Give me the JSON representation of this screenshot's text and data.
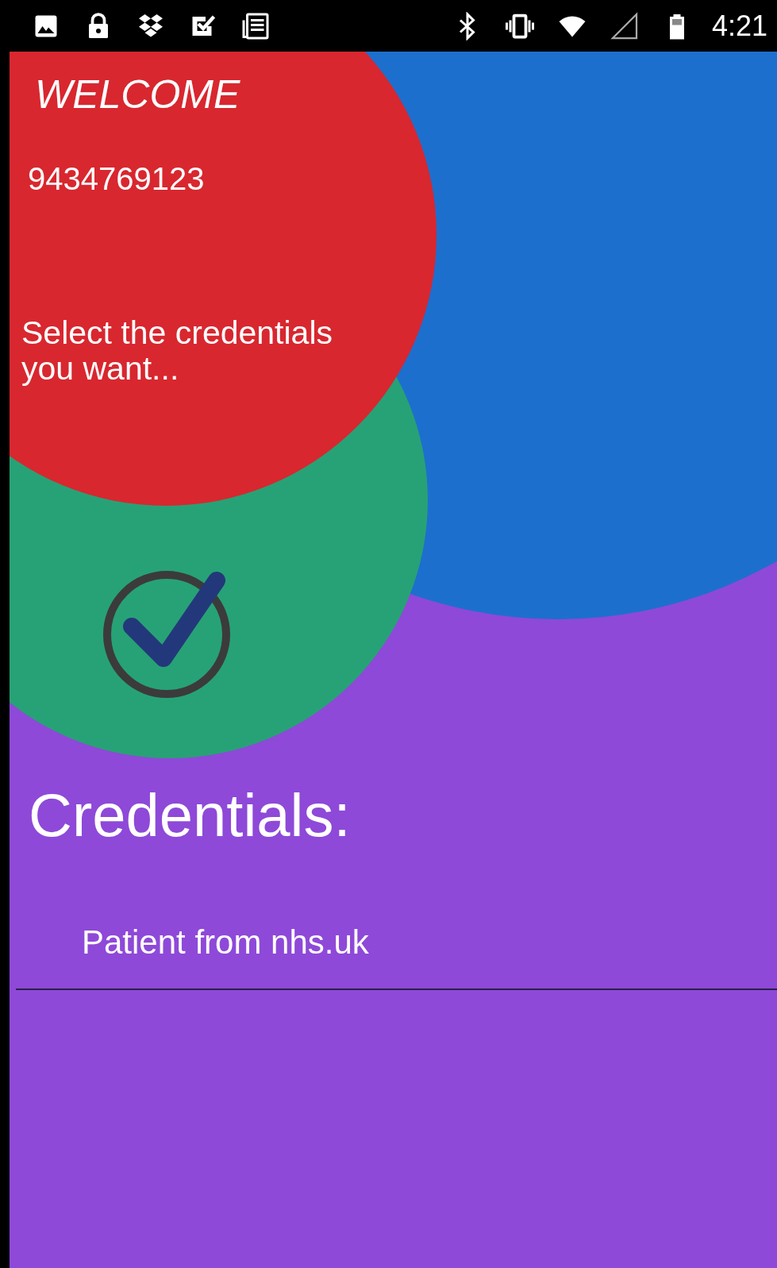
{
  "status_bar": {
    "time": "4:21"
  },
  "header": {
    "title": "WELCOME",
    "phone": "9434769123",
    "prompt": "Select the credentials you want..."
  },
  "section": {
    "title": "Credentials:"
  },
  "credentials": [
    {
      "label": "Patient from nhs.uk"
    }
  ]
}
